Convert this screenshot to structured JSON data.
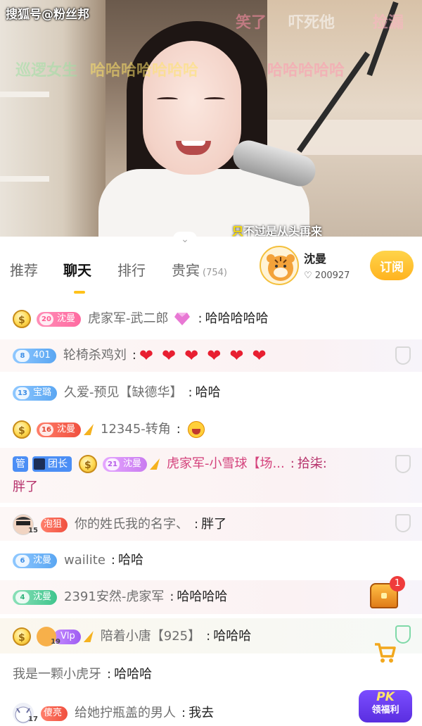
{
  "watermark": "搜狐号@粉丝邦",
  "video": {
    "danmu": [
      "巡逻女生",
      "哈哈哈哈哈哈哈",
      "笑了",
      "吓死他",
      "捡漏",
      "哈哈哈哈哈"
    ],
    "subtitle_first": "只",
    "subtitle_rest": "不过是从头再来"
  },
  "tabs": [
    {
      "label": "推荐",
      "active": false
    },
    {
      "label": "聊天",
      "active": true
    },
    {
      "label": "排行",
      "active": false
    },
    {
      "label": "贵宾",
      "active": false,
      "count": "(754)"
    }
  ],
  "anchor": {
    "name": "沈曼",
    "fans": "200927",
    "subscribe_label": "订阅"
  },
  "messages": [
    {
      "badge": "沈曼",
      "lv": "20",
      "user": "虎家军-武二郎",
      "text": "哈哈哈哈哈"
    },
    {
      "badge": "401",
      "lv": "8",
      "user": "轮椅杀鸡刘",
      "hearts": 6
    },
    {
      "badge": "宝璐",
      "lv": "13",
      "user": "久爱-预见【缺德华】",
      "text": "哈哈"
    },
    {
      "badge": "沈曼",
      "lv": "16",
      "user": "12345-转角"
    },
    {
      "mgr": "管",
      "tuan": "团长",
      "badge": "沈曼",
      "lv": "21",
      "user": "虎家军-小雪球【场...",
      "text": "拾柒:",
      "text2": "胖了"
    },
    {
      "badge": "泡狙",
      "lv": "15",
      "user": "你的姓氏我的名字、",
      "text": "胖了"
    },
    {
      "badge": "沈曼",
      "lv": "6",
      "user": "wailite",
      "text": "哈哈"
    },
    {
      "badge": "沈曼",
      "lv": "4",
      "user": "2391安然-虎家军",
      "text": "哈哈哈哈"
    },
    {
      "badge": "Vlp",
      "lv": "19",
      "user": "陪着小唐【925】",
      "text": "哈哈哈"
    },
    {
      "user": "我是一颗小虎牙",
      "text": "哈哈哈"
    },
    {
      "badge": "傻亮",
      "lv": "17",
      "user": "给她拧瓶盖的男人",
      "text": "我去"
    }
  ],
  "widgets": {
    "chest_count": "1",
    "pk_title": "PK",
    "pk_sub": "领福利"
  },
  "colors": {
    "accent": "#ffc21a",
    "subscribe": "#ffb320",
    "pk": "#6a3cf0",
    "heart": "#e81f31"
  }
}
